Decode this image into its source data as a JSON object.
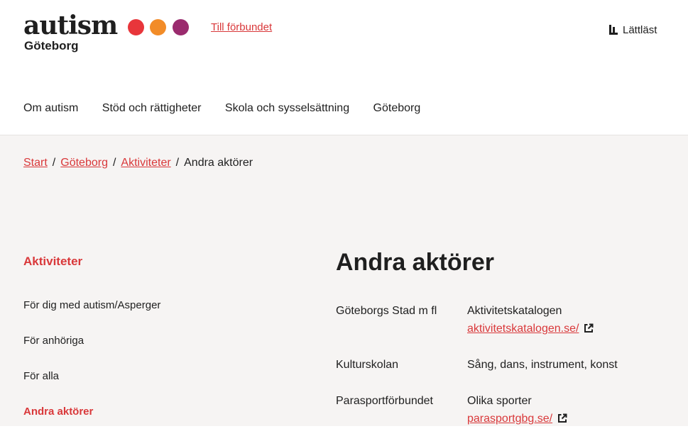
{
  "header": {
    "logo": {
      "word": "autism",
      "city": "Göteborg",
      "dot_colors": [
        "#e8363b",
        "#f28c28",
        "#9a2b6e"
      ]
    },
    "federation_link": "Till förbundet",
    "easy_read": {
      "icon": "easy-read-icon",
      "label": "Lättläst"
    }
  },
  "main_nav": [
    "Om autism",
    "Stöd och rättigheter",
    "Skola och sysselsättning",
    "Göteborg"
  ],
  "breadcrumb": {
    "items": [
      "Start",
      "Göteborg",
      "Aktiviteter"
    ],
    "current": "Andra aktörer",
    "separator": "/"
  },
  "sidebar": {
    "title": "Aktiviteter",
    "items": [
      "För dig med autism/Asperger",
      "För anhöriga",
      "För alla",
      "Andra aktörer"
    ],
    "active_index": 3
  },
  "page": {
    "title": "Andra aktörer",
    "actors": [
      {
        "org": "Göteborgs Stad m fl",
        "desc": "Aktivitetskatalogen",
        "link": "aktivitetskatalogen.se/"
      },
      {
        "org": "Kulturskolan",
        "desc": "Sång, dans, instrument, konst"
      },
      {
        "org": "Parasportförbundet",
        "desc": "Olika sporter",
        "link": "parasportgbg.se/"
      }
    ]
  },
  "colors": {
    "accent": "#d9383a",
    "text": "#1f1f1f",
    "content_bg": "#f6f4f3"
  }
}
